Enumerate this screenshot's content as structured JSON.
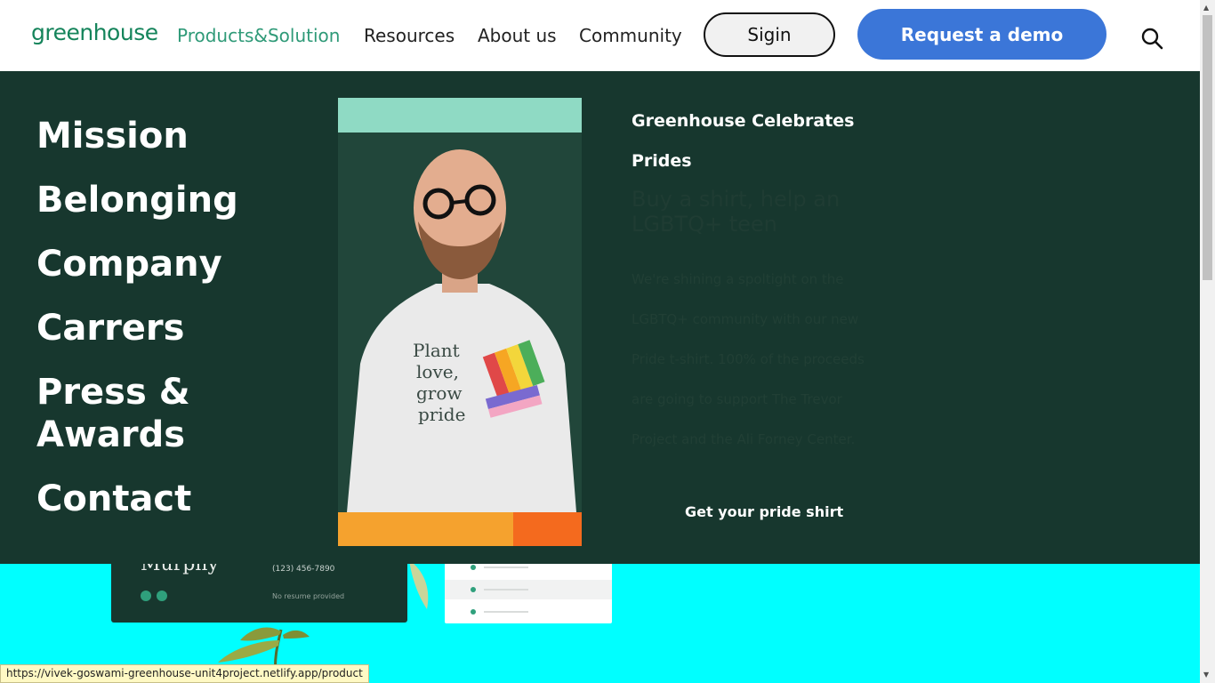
{
  "header": {
    "logo": "greenhouse",
    "nav": [
      "Products&Solution",
      "Resources",
      "About us",
      "Community"
    ],
    "signin_label": "Sigin",
    "demo_label": "Request a demo"
  },
  "menu": {
    "items": [
      "Mission",
      "Belonging",
      "Company",
      "Carrers",
      "Press & Awards",
      "Contact"
    ]
  },
  "promo": {
    "title": "Greenhouse Celebrates Prides",
    "subtitle": "Buy a shirt, help an LGBTQ+ teen",
    "body": "We're shining a spoltight on the LGBTQ+ community with our new Pride t-shirt. 100% of the proceeds are going to support The Trevor Project and the Ali Forney Center.",
    "cta": "Get your pride shirt",
    "shirt_text": [
      "Plant",
      "love,",
      "grow",
      "pride"
    ]
  },
  "background_card": {
    "name": "Murphy",
    "phone": "(123) 456-7890",
    "resume": "No resume provided"
  },
  "status_bar": {
    "url": "https://vivek-goswami-greenhouse-unit4project.netlify.app/product"
  },
  "colors": {
    "header_bg": "#ffffff",
    "panel_bg": "#17372e",
    "accent_green": "#2f9a78",
    "demo_blue": "#3b76d8",
    "page_bg": "#00ffff"
  }
}
